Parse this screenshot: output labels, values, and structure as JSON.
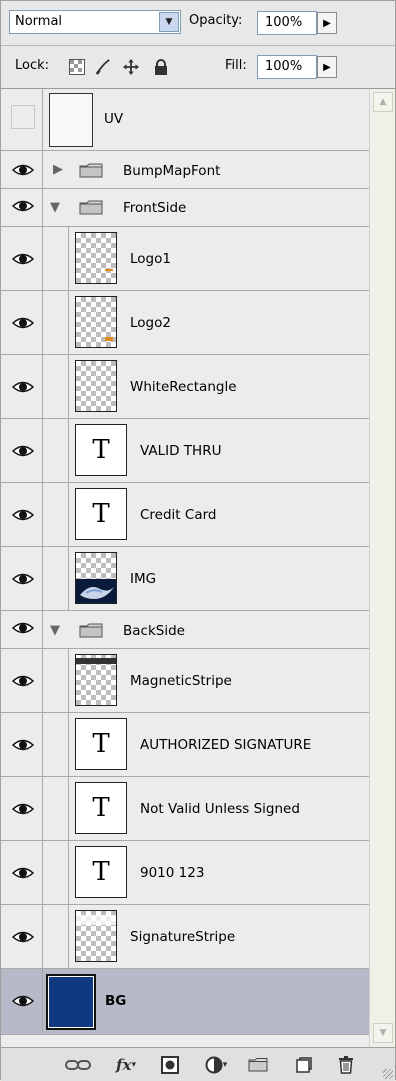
{
  "toolbar": {
    "blend_mode": "Normal",
    "opacity_label": "Opacity:",
    "opacity_value": "100%",
    "lock_label": "Lock:",
    "fill_label": "Fill:",
    "fill_value": "100%",
    "lock_icons": [
      "lock-transparent-pixels-icon",
      "lock-image-pixels-icon",
      "lock-position-icon",
      "lock-all-icon"
    ]
  },
  "layers": [
    {
      "name": "UV",
      "kind": "layer",
      "visible": false,
      "thumb": "blank"
    },
    {
      "name": "BumpMapFont",
      "kind": "group",
      "expanded": false,
      "visible": true
    },
    {
      "name": "FrontSide",
      "kind": "group",
      "expanded": true,
      "visible": true
    },
    {
      "name": "Logo1",
      "kind": "layer",
      "visible": true,
      "thumb": "checker",
      "indent": true
    },
    {
      "name": "Logo2",
      "kind": "layer",
      "visible": true,
      "thumb": "checker",
      "indent": true
    },
    {
      "name": "WhiteRectangle",
      "kind": "layer",
      "visible": true,
      "thumb": "checker",
      "indent": true
    },
    {
      "name": "VALID THRU",
      "kind": "text",
      "visible": true,
      "indent": true
    },
    {
      "name": "Credit Card",
      "kind": "text",
      "visible": true,
      "indent": true
    },
    {
      "name": "IMG",
      "kind": "layer",
      "visible": true,
      "thumb": "image",
      "indent": true
    },
    {
      "name": "BackSide",
      "kind": "group",
      "expanded": true,
      "visible": true
    },
    {
      "name": "MagneticStripe",
      "kind": "layer",
      "visible": true,
      "thumb": "checker-stripe",
      "indent": true
    },
    {
      "name": "AUTHORIZED SIGNATURE",
      "kind": "text",
      "visible": true,
      "indent": true
    },
    {
      "name": "Not Valid Unless Signed",
      "kind": "text",
      "visible": true,
      "indent": true
    },
    {
      "name": "9010 123",
      "kind": "text",
      "visible": true,
      "indent": true
    },
    {
      "name": "SignatureStripe",
      "kind": "layer",
      "visible": true,
      "thumb": "checker-light",
      "indent": true
    },
    {
      "name": "BG",
      "kind": "layer",
      "visible": true,
      "thumb": "blue",
      "selected": true
    }
  ],
  "text_thumb_glyph": "T",
  "bottom_icons": [
    "link-layers-icon",
    "layer-style-fx-icon",
    "add-mask-icon",
    "adjustment-layer-icon",
    "new-group-icon",
    "new-layer-icon",
    "delete-layer-icon"
  ],
  "colors": {
    "selected_row": "#b6b9c8",
    "bg_thumb": "#0f3a82"
  }
}
